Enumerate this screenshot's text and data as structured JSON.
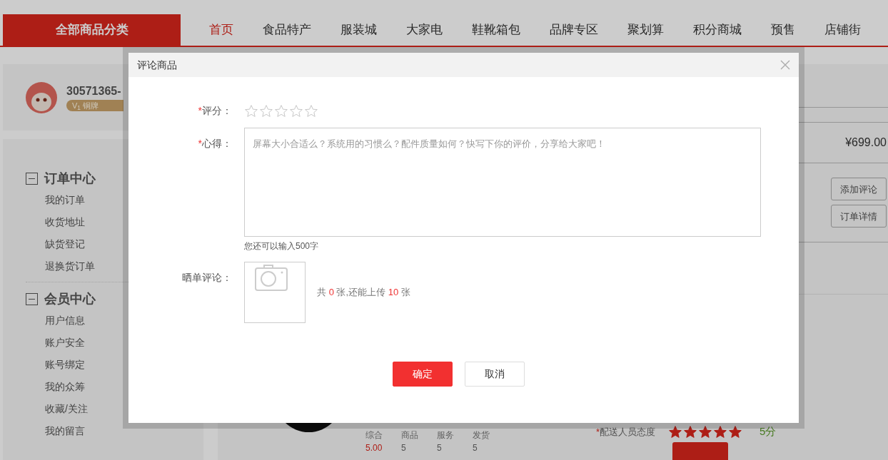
{
  "top_nav": {
    "category_button": "全部商品分类",
    "items": [
      {
        "label": "首页",
        "selected": true
      },
      {
        "label": "食品特产",
        "selected": false
      },
      {
        "label": "服装城",
        "selected": false
      },
      {
        "label": "大家电",
        "selected": false
      },
      {
        "label": "鞋靴箱包",
        "selected": false
      },
      {
        "label": "品牌专区",
        "selected": false
      },
      {
        "label": "聚划算",
        "selected": false
      },
      {
        "label": "积分商城",
        "selected": false
      },
      {
        "label": "预售",
        "selected": false
      },
      {
        "label": "店铺街",
        "selected": false
      }
    ]
  },
  "user": {
    "name": "30571365-",
    "badge": "V$_{1}$ 铜牌"
  },
  "sidebar": {
    "groups": [
      {
        "title": "订单中心",
        "expanded": true,
        "items": [
          "我的订单",
          "收货地址",
          "缺货登记",
          "退换货订单"
        ]
      },
      {
        "title": "会员中心",
        "expanded": true,
        "items": [
          "用户信息",
          "账户安全",
          "账号绑定",
          "我的众筹",
          "收藏/关注",
          "我的留言"
        ]
      }
    ]
  },
  "order": {
    "price": "¥699.00",
    "actions": [
      "添加评论",
      "订单详情"
    ],
    "shop_scores": [
      {
        "label": "综合",
        "value": "5.00",
        "highlight": true
      },
      {
        "label": "商品",
        "value": "5",
        "highlight": false
      },
      {
        "label": "服务",
        "value": "5",
        "highlight": false
      },
      {
        "label": "发货",
        "value": "5",
        "highlight": false
      }
    ],
    "delivery_rating": {
      "mark": "*",
      "label": "配送人员态度",
      "stars": 5,
      "score": "5分"
    }
  },
  "dialog": {
    "title": "评论商品",
    "rating": {
      "mark": "*",
      "label": "评分：",
      "stars": 0
    },
    "comment": {
      "mark": "*",
      "label": "心得：",
      "placeholder": "屏幕大小合适么？系统用的习惯么？配件质量如何？快写下你的评价，分享给大家吧！",
      "counter": "您还可以输入500字"
    },
    "photos": {
      "label": "晒单评论：",
      "hint": {
        "prefix": "共",
        "count": "0",
        "middle": "张,还能上传",
        "remaining": "10",
        "suffix": "张"
      }
    },
    "buttons": [
      {
        "label": "确定",
        "kind": "primary"
      },
      {
        "label": "取消",
        "kind": "secondary"
      }
    ]
  }
}
